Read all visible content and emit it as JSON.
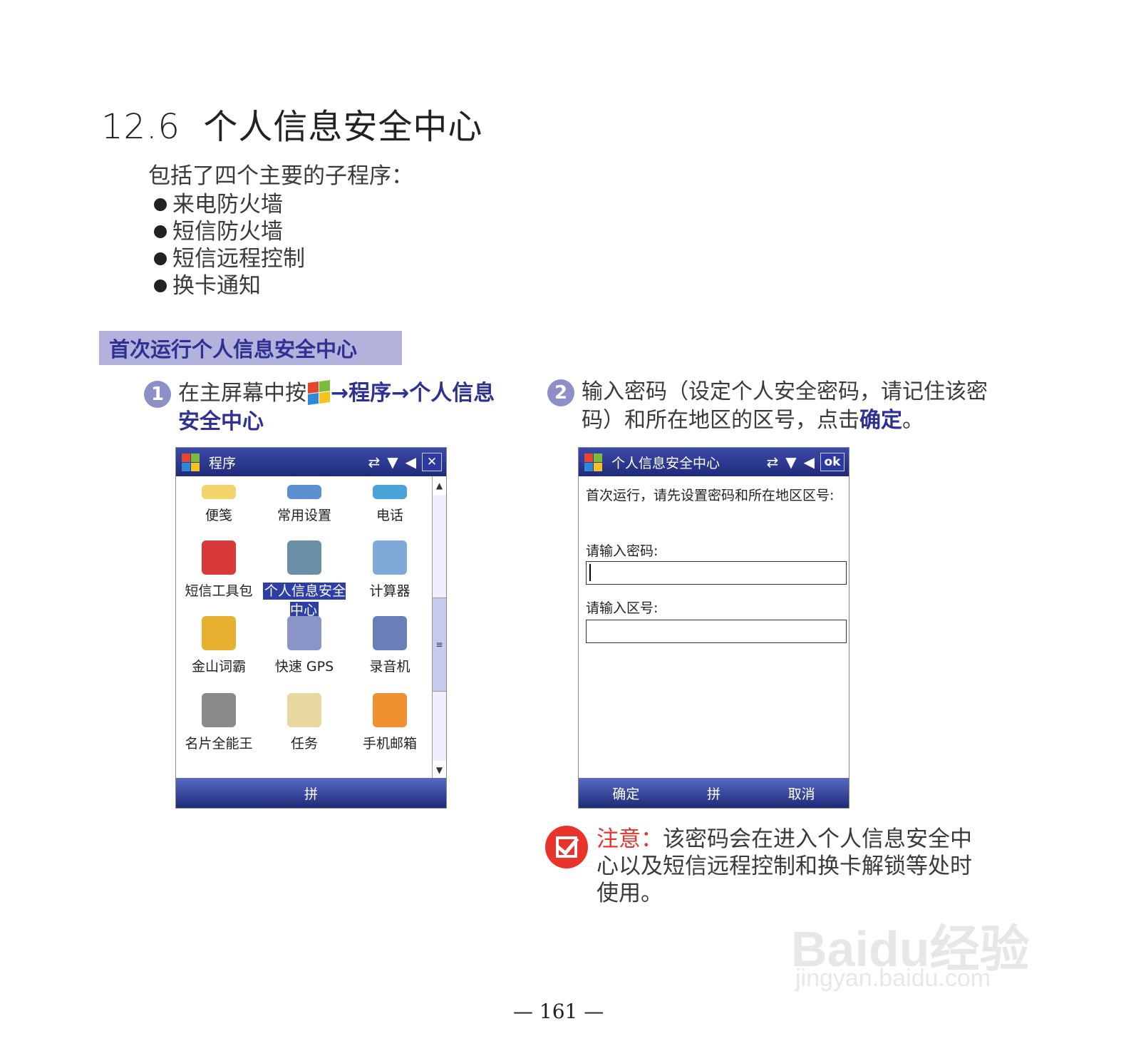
{
  "section": {
    "number": "12.6",
    "title": "个人信息安全中心"
  },
  "intro": "包括了四个主要的子程序：",
  "bullets": [
    "来电防火墙",
    "短信防火墙",
    "短信远程控制",
    "换卡通知"
  ],
  "banner": "首次运行个人信息安全中心",
  "step1": {
    "num": "1",
    "text_a": "在主屏幕中按",
    "arrow": "→",
    "bold_a": "程序",
    "bold_b": "个人信息安全中心"
  },
  "step2": {
    "num": "2",
    "text_a": "输入密码（设定个人安全密码，请记住该密码）和所在地区的区号，点击",
    "bold": "确定",
    "text_b": "。"
  },
  "screen1": {
    "title": "程序",
    "icons": [
      "sync-icon",
      "signal-icon",
      "volume-icon"
    ],
    "close_label": "✕",
    "apps": [
      "便笺",
      "常用设置",
      "电话",
      "短信工具包",
      "个人信息安全中心",
      "计算器",
      "金山词霸",
      "快速 GPS",
      "录音机",
      "名片全能王",
      "任务",
      "手机邮箱"
    ],
    "softkey": "拼"
  },
  "screen2": {
    "title": "个人信息安全中心",
    "ok_label": "ok",
    "prompt": "首次运行，请先设置密码和所在地区区号:",
    "password_label": "请输入密码:",
    "area_label": "请输入区号:",
    "softkeys": [
      "确定",
      "拼",
      "取消"
    ]
  },
  "note": {
    "label": "注意：",
    "text": "该密码会在进入个人信息安全中心以及短信远程控制和换卡解锁等处时使用。"
  },
  "watermark": {
    "brand": "Baidu经验",
    "url": "jingyan.baidu.com"
  },
  "page_number": "— 161 —",
  "colors": {
    "accent": "#2e3192",
    "banner_bg": "#b2b2dd",
    "step_circle": "#8e8ec8",
    "note_red": "#e8342b"
  }
}
